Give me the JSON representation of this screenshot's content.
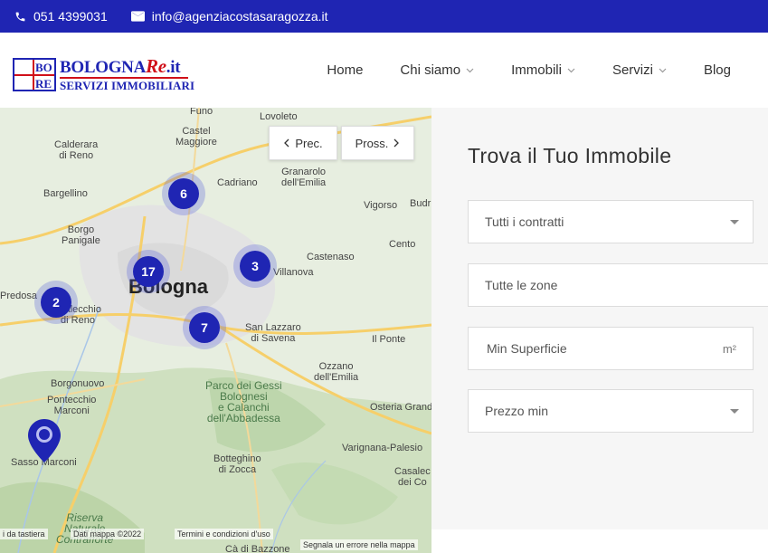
{
  "topbar": {
    "phone": "051 4399031",
    "email": "info@agenziacostasaragozza.it",
    "phone_icon": "phone-icon",
    "email_icon": "envelope-icon"
  },
  "logo": {
    "box_top": "BO",
    "box_bottom": "RE",
    "name_main": "BOLOGNA",
    "name_re": "Re",
    "name_tld": ".it",
    "subtitle": "SERVIZI IMMOBILIARI"
  },
  "nav": {
    "home": "Home",
    "chi_siamo": "Chi siamo",
    "immobili": "Immobili",
    "servizi": "Servizi",
    "blog": "Blog"
  },
  "map": {
    "prev_label": "Prec.",
    "next_label": "Pross.",
    "clusters": [
      {
        "count": "6"
      },
      {
        "count": "17"
      },
      {
        "count": "3"
      },
      {
        "count": "2"
      },
      {
        "count": "7"
      }
    ],
    "labels": {
      "funo": "Funo",
      "castel_maggiore": "Castel\nMaggiore",
      "lovoleto": "Lovoleto",
      "calderara": "Calderara\ndi Reno",
      "bargellino": "Bargellino",
      "cadriano": "Cadriano",
      "granarolo": "Granarolo\ndell'Emilia",
      "vigorso": "Vigorso",
      "budr": "Budr",
      "borgo_panigale": "Borgo\nPanigale",
      "castenaso": "Castenaso",
      "cento": "Cento",
      "bologna": "Bologna",
      "villanova": "Villanova",
      "predosa": "Predosa",
      "casalecchio": "asalecchio\ndi Reno",
      "san_lazzaro": "San Lazzaro\ndi Savena",
      "il_ponte": "Il Ponte",
      "ozzano": "Ozzano\ndell'Emilia",
      "borgonuovo": "Borgonuovo",
      "pontecchio": "Pontecchio\nMarconi",
      "parco": "Parco dei Gessi\nBolognesi\ne Calanchi\ndell'Abbadessa",
      "osteria_grande": "Osteria Grand",
      "varignana": "Varignana-Palesio",
      "sasso_marconi": "Sasso Marconi",
      "botteghino": "Botteghino\ndi Zocca",
      "casalecchio_dei": "Casalec\ndei Co",
      "riserva": "Riserva\nNaturale\nContrafforte",
      "ca_bazzone": "Cà di Bazzone"
    },
    "attribution": {
      "keyboard": "i da tastiera",
      "map_data": "Dati mappa ©2022",
      "terms": "Termini e condizioni d'uso",
      "report": "Segnala un errore nella mappa"
    }
  },
  "search": {
    "title": "Trova il Tuo Immobile",
    "contract": "Tutti i contratti",
    "zones": "Tutte le zone",
    "min_surface": "Min Superficie",
    "surface_unit": "m²",
    "min_price": "Prezzo min"
  },
  "colors": {
    "brand_blue": "#1f25b3",
    "brand_red": "#d0101a"
  }
}
